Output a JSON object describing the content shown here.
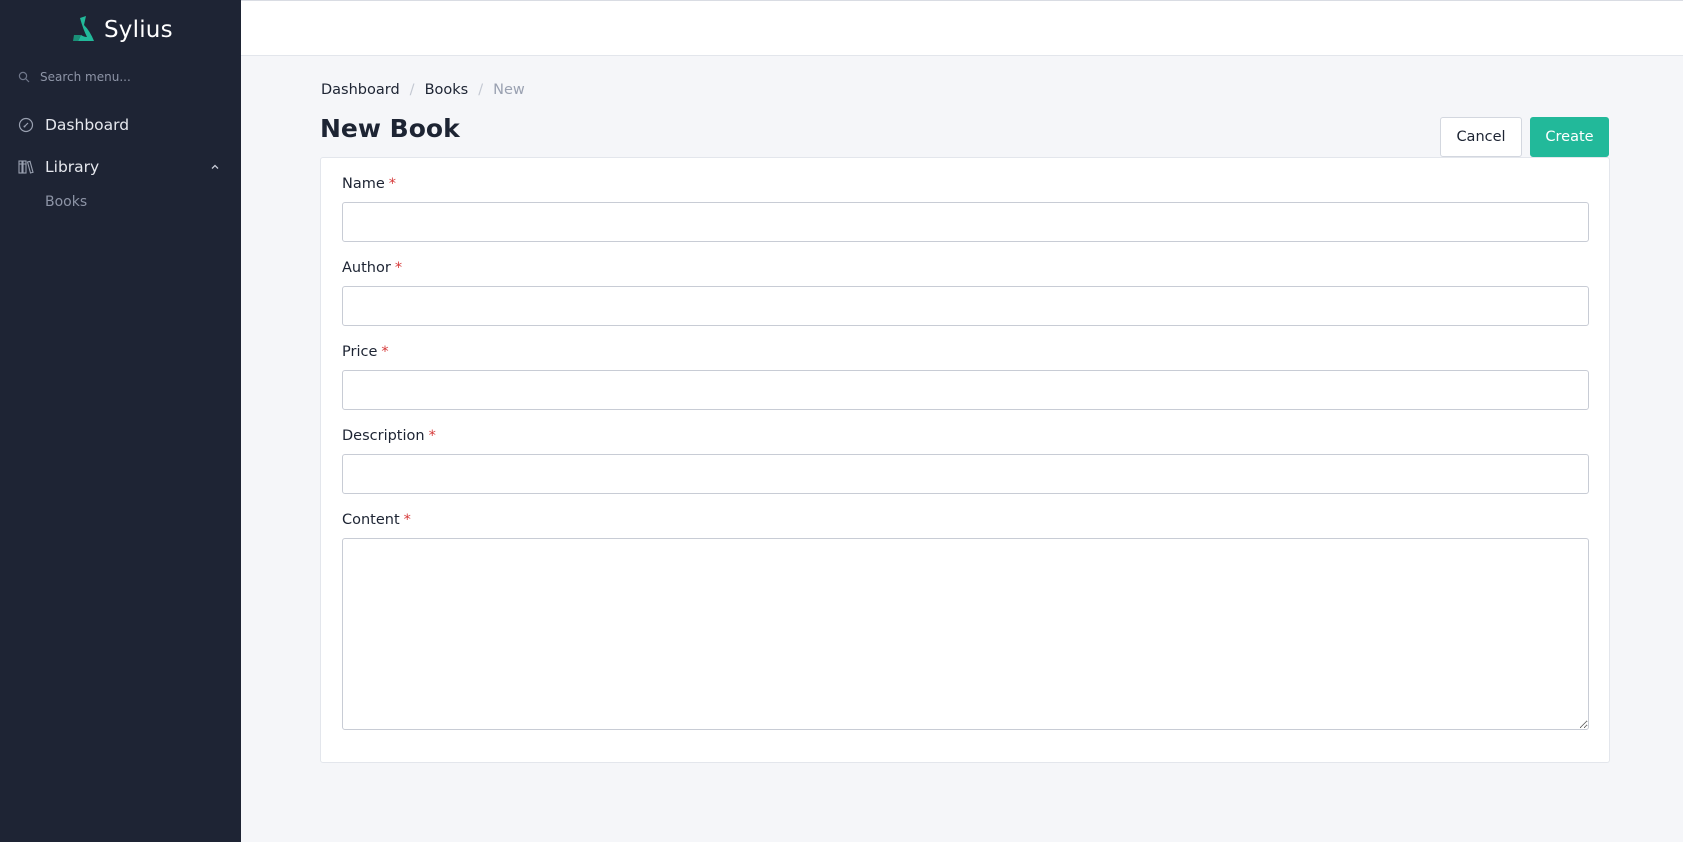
{
  "brand": {
    "name": "Sylius",
    "accent": "#22b99a"
  },
  "sidebar": {
    "search_placeholder": "Search menu...",
    "items": [
      {
        "label": "Dashboard",
        "icon": "gauge-icon"
      },
      {
        "label": "Library",
        "icon": "books-icon",
        "expanded": true,
        "children": [
          {
            "label": "Books"
          }
        ]
      }
    ]
  },
  "breadcrumb": {
    "items": [
      "Dashboard",
      "Books",
      "New"
    ],
    "separator": "/"
  },
  "page": {
    "title": "New Book"
  },
  "actions": {
    "cancel_label": "Cancel",
    "create_label": "Create"
  },
  "form": {
    "required_marker": "*",
    "fields": [
      {
        "label": "Name",
        "value": "",
        "required": true
      },
      {
        "label": "Author",
        "value": "",
        "required": true
      },
      {
        "label": "Price",
        "value": "",
        "required": true
      },
      {
        "label": "Description",
        "value": "",
        "required": true
      },
      {
        "label": "Content",
        "value": "",
        "required": true
      }
    ]
  },
  "colors": {
    "sidebar_bg": "#1e2434",
    "page_bg": "#f5f6f9",
    "primary": "#22b99a",
    "required": "#d63939"
  }
}
